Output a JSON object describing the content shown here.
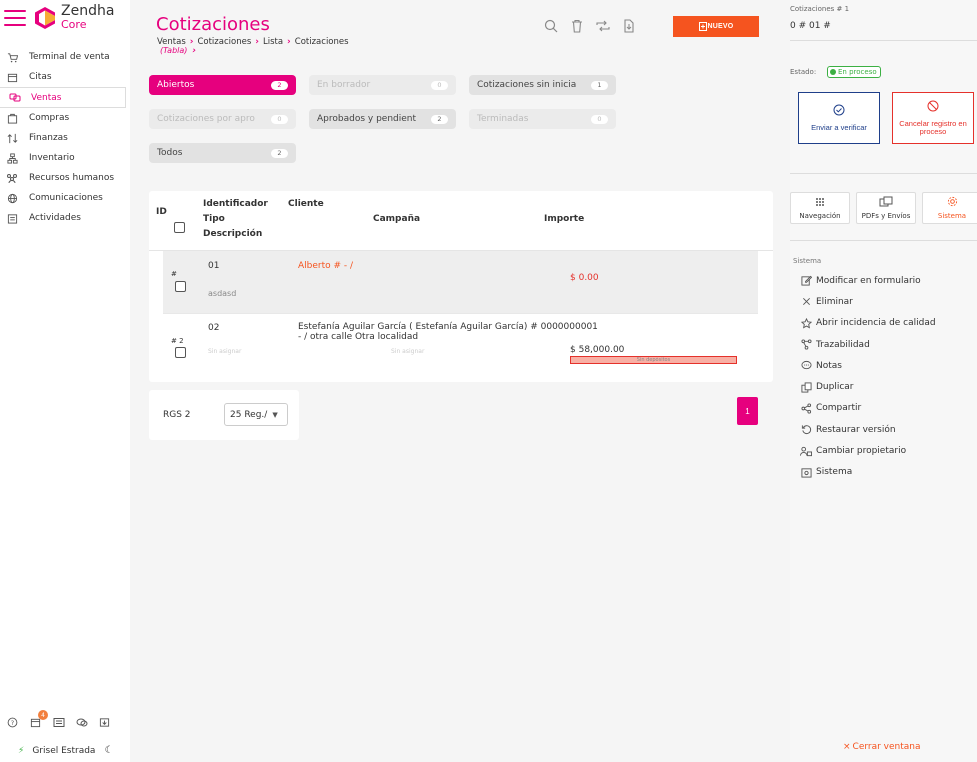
{
  "app": {
    "name": "Zendha",
    "subtitle": "Core"
  },
  "nav": [
    {
      "label": "Terminal de venta",
      "icon": "cart-icon"
    },
    {
      "label": "Citas",
      "icon": "calendar-icon"
    },
    {
      "label": "Ventas",
      "icon": "sales-icon",
      "active": true
    },
    {
      "label": "Compras",
      "icon": "purchases-icon"
    },
    {
      "label": "Finanzas",
      "icon": "finance-icon"
    },
    {
      "label": "Inventario",
      "icon": "inventory-icon"
    },
    {
      "label": "Recursos humanos",
      "icon": "people-icon"
    },
    {
      "label": "Comunicaciones",
      "icon": "globe-icon"
    },
    {
      "label": "Actividades",
      "icon": "activities-icon"
    }
  ],
  "footer": {
    "notifications": "4",
    "user": "Grisel Estrada"
  },
  "header": {
    "title": "Cotizaciones",
    "breadcrumb": [
      "Ventas",
      "Cotizaciones",
      "Lista",
      "Cotizaciones"
    ],
    "view": "(Tabla)",
    "new_label": "NUEVO"
  },
  "filters": [
    {
      "label": "Abiertos",
      "count": "2",
      "state": "active"
    },
    {
      "label": "En borrador",
      "count": "0",
      "state": "disabled"
    },
    {
      "label": "Cotizaciones sin inicia",
      "count": "1",
      "state": "normal"
    },
    {
      "label": "Cotizaciones por apro",
      "count": "0",
      "state": "disabled"
    },
    {
      "label": "Aprobados y pendient",
      "count": "2",
      "state": "normal"
    },
    {
      "label": "Terminadas",
      "count": "0",
      "state": "disabled"
    },
    {
      "label": "Todos",
      "count": "2",
      "state": "normal"
    }
  ],
  "table": {
    "headers": {
      "id": "ID",
      "identificador": "Identificador",
      "tipo": "Tipo",
      "descripcion": "Descripción",
      "cliente": "Cliente",
      "campana": "Campaña",
      "importe": "Importe"
    },
    "rows": [
      {
        "hash": "#",
        "identifier": "01",
        "description": "asdasd",
        "client": "Alberto # - /",
        "tipo": "",
        "campaign": "",
        "amount": "$ 0.00",
        "deposit": ""
      },
      {
        "hash": "# 2",
        "identifier": "02",
        "description": "",
        "client": "Estefanía Aguilar García ( Estefanía Aguilar García) # 0000000001 - / otra calle Otra localidad",
        "tipo": "Sin asignar",
        "campaign": "Sin asignar",
        "amount": "$ 58,000.00",
        "deposit": "Sin depósitos"
      }
    ]
  },
  "pagination": {
    "rgs": "RGS 2",
    "per_page": "25 Reg./",
    "current_page": "1"
  },
  "panel": {
    "label": "Cotizaciones # 1",
    "id": "0 # 01 #",
    "estado_label": "Estado:",
    "status": "En proceso",
    "verify": "Enviar a verificar",
    "cancel": "Cancelar registro en proceso",
    "tabs": [
      "Navegación",
      "PDFs y Envíos",
      "Sistema"
    ],
    "system_title": "Sistema",
    "system_items": [
      {
        "label": "Modificar en formulario",
        "icon": "edit-icon"
      },
      {
        "label": "Eliminar",
        "icon": "x-icon"
      },
      {
        "label": "Abrir incidencia de calidad",
        "icon": "star-icon"
      },
      {
        "label": "Trazabilidad",
        "icon": "trace-icon"
      },
      {
        "label": "Notas",
        "icon": "notes-icon"
      },
      {
        "label": "Duplicar",
        "icon": "duplicate-icon"
      },
      {
        "label": "Compartir",
        "icon": "share-icon"
      },
      {
        "label": "Restaurar versión",
        "icon": "restore-icon"
      },
      {
        "label": "Cambiar propietario",
        "icon": "owner-icon"
      },
      {
        "label": "Sistema",
        "icon": "system-icon"
      }
    ],
    "close": "Cerrar ventana"
  },
  "colors": {
    "brand": "#e6007e",
    "accent": "#f5541f",
    "danger": "#e5312b",
    "navy": "#1f3f8a",
    "success": "#3cb043"
  }
}
